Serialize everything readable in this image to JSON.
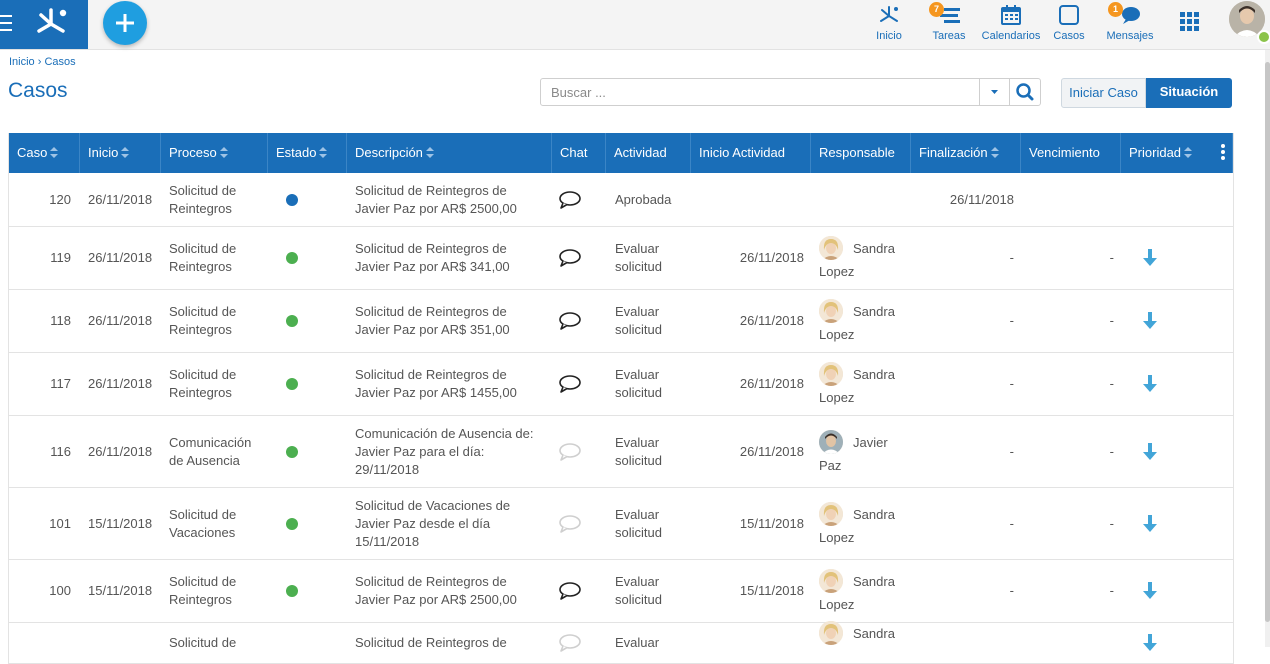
{
  "nav": {
    "inicio": "Inicio",
    "tareas": "Tareas",
    "tareas_badge": "7",
    "calendarios": "Calendarios",
    "casos": "Casos",
    "mensajes": "Mensajes",
    "mensajes_badge": "1"
  },
  "breadcrumb": {
    "home": "Inicio",
    "sep": "›",
    "current": "Casos"
  },
  "page_title": "Casos",
  "search": {
    "placeholder": "Buscar ..."
  },
  "buttons": {
    "iniciar": "Iniciar Caso",
    "situacion": "Situación"
  },
  "columns": [
    "Caso",
    "Inicio",
    "Proceso",
    "Estado",
    "Descripción",
    "Chat",
    "Actividad",
    "Inicio Actividad",
    "Responsable",
    "Finalización",
    "Vencimiento",
    "Prioridad"
  ],
  "colors": {
    "brand": "#1a6eb8",
    "accent": "#1f9ee0",
    "status_blue": "#1a6eb8",
    "status_green": "#4caf50",
    "badge": "#f5961f",
    "priority_arrow": "#42a5d8"
  },
  "rows": [
    {
      "caso": "120",
      "inicio": "26/11/2018",
      "proceso": [
        "Solicitud de",
        "Reintegros"
      ],
      "estado": "blue",
      "descripcion": [
        "Solicitud de Reintegros de",
        "Javier Paz por AR$ 2500,00"
      ],
      "chat": "active",
      "actividad": [
        "Aprobada"
      ],
      "inicio_actividad": "",
      "responsable": [],
      "resp_avatar": "",
      "finalizacion": "26/11/2018",
      "vencimiento": "",
      "prioridad": ""
    },
    {
      "caso": "119",
      "inicio": "26/11/2018",
      "proceso": [
        "Solicitud de",
        "Reintegros"
      ],
      "estado": "green",
      "descripcion": [
        "Solicitud de Reintegros de",
        "Javier Paz por AR$ 341,00"
      ],
      "chat": "active",
      "actividad": [
        "Evaluar",
        "solicitud"
      ],
      "inicio_actividad": "26/11/2018",
      "responsable": [
        "Sandra",
        "Lopez"
      ],
      "resp_avatar": "sandra",
      "finalizacion": "-",
      "vencimiento": "-",
      "prioridad": "down"
    },
    {
      "caso": "118",
      "inicio": "26/11/2018",
      "proceso": [
        "Solicitud de",
        "Reintegros"
      ],
      "estado": "green",
      "descripcion": [
        "Solicitud de Reintegros de",
        "Javier Paz por AR$ 351,00"
      ],
      "chat": "active",
      "actividad": [
        "Evaluar",
        "solicitud"
      ],
      "inicio_actividad": "26/11/2018",
      "responsable": [
        "Sandra",
        "Lopez"
      ],
      "resp_avatar": "sandra",
      "finalizacion": "-",
      "vencimiento": "-",
      "prioridad": "down"
    },
    {
      "caso": "117",
      "inicio": "26/11/2018",
      "proceso": [
        "Solicitud de",
        "Reintegros"
      ],
      "estado": "green",
      "descripcion": [
        "Solicitud de Reintegros de",
        "Javier Paz por AR$ 1455,00"
      ],
      "chat": "active",
      "actividad": [
        "Evaluar",
        "solicitud"
      ],
      "inicio_actividad": "26/11/2018",
      "responsable": [
        "Sandra",
        "Lopez"
      ],
      "resp_avatar": "sandra",
      "finalizacion": "-",
      "vencimiento": "-",
      "prioridad": "down"
    },
    {
      "caso": "116",
      "inicio": "26/11/2018",
      "proceso": [
        "Comunicación",
        "de Ausencia"
      ],
      "estado": "green",
      "descripcion": [
        "Comunicación de Ausencia de:",
        "Javier Paz para el día:",
        "29/11/2018"
      ],
      "chat": "inactive",
      "actividad": [
        "Evaluar",
        "solicitud"
      ],
      "inicio_actividad": "26/11/2018",
      "responsable": [
        "Javier",
        "Paz"
      ],
      "resp_avatar": "javier",
      "finalizacion": "-",
      "vencimiento": "-",
      "prioridad": "down"
    },
    {
      "caso": "101",
      "inicio": "15/11/2018",
      "proceso": [
        "Solicitud de",
        "Vacaciones"
      ],
      "estado": "green",
      "descripcion": [
        "Solicitud de Vacaciones de",
        "Javier Paz desde el día",
        "15/11/2018"
      ],
      "chat": "inactive",
      "actividad": [
        "Evaluar",
        "solicitud"
      ],
      "inicio_actividad": "15/11/2018",
      "responsable": [
        "Sandra",
        "Lopez"
      ],
      "resp_avatar": "sandra",
      "finalizacion": "-",
      "vencimiento": "-",
      "prioridad": "down"
    },
    {
      "caso": "100",
      "inicio": "15/11/2018",
      "proceso": [
        "Solicitud de",
        "Reintegros"
      ],
      "estado": "green",
      "descripcion": [
        "Solicitud de Reintegros de",
        "Javier Paz por AR$ 2500,00"
      ],
      "chat": "active",
      "actividad": [
        "Evaluar",
        "solicitud"
      ],
      "inicio_actividad": "15/11/2018",
      "responsable": [
        "Sandra",
        "Lopez"
      ],
      "resp_avatar": "sandra",
      "finalizacion": "-",
      "vencimiento": "-",
      "prioridad": "down"
    },
    {
      "caso": "",
      "inicio": "",
      "proceso": [
        "Solicitud de"
      ],
      "estado": "",
      "descripcion": [
        "Solicitud de Reintegros de"
      ],
      "chat": "inactive",
      "actividad": [
        "Evaluar"
      ],
      "inicio_actividad": "",
      "responsable": [
        "Sandra"
      ],
      "resp_avatar": "sandra",
      "finalizacion": "",
      "vencimiento": "",
      "prioridad": "down"
    }
  ]
}
